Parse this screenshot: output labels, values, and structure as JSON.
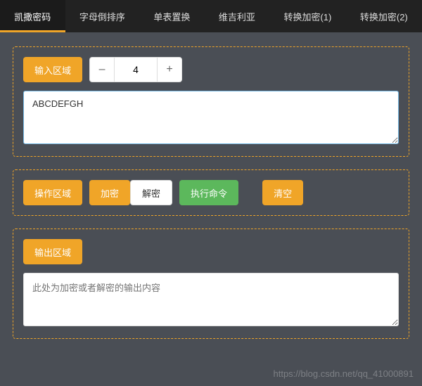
{
  "tabs": [
    {
      "label": "凯撒密码",
      "active": true
    },
    {
      "label": "字母倒排序",
      "active": false
    },
    {
      "label": "单表置换",
      "active": false
    },
    {
      "label": "维吉利亚",
      "active": false
    },
    {
      "label": "转换加密(1)",
      "active": false
    },
    {
      "label": "转换加密(2)",
      "active": false
    }
  ],
  "input_panel": {
    "badge": "输入区域",
    "stepper": {
      "minus": "–",
      "value": "4",
      "plus": "+"
    },
    "textarea_value": "ABCDEFGH"
  },
  "action_panel": {
    "badge": "操作区域",
    "encrypt": "加密",
    "decrypt": "解密",
    "execute": "执行命令",
    "clear": "清空"
  },
  "output_panel": {
    "badge": "输出区域",
    "placeholder": "此处为加密或者解密的输出内容"
  },
  "watermark": "https://blog.csdn.net/qq_41000891"
}
